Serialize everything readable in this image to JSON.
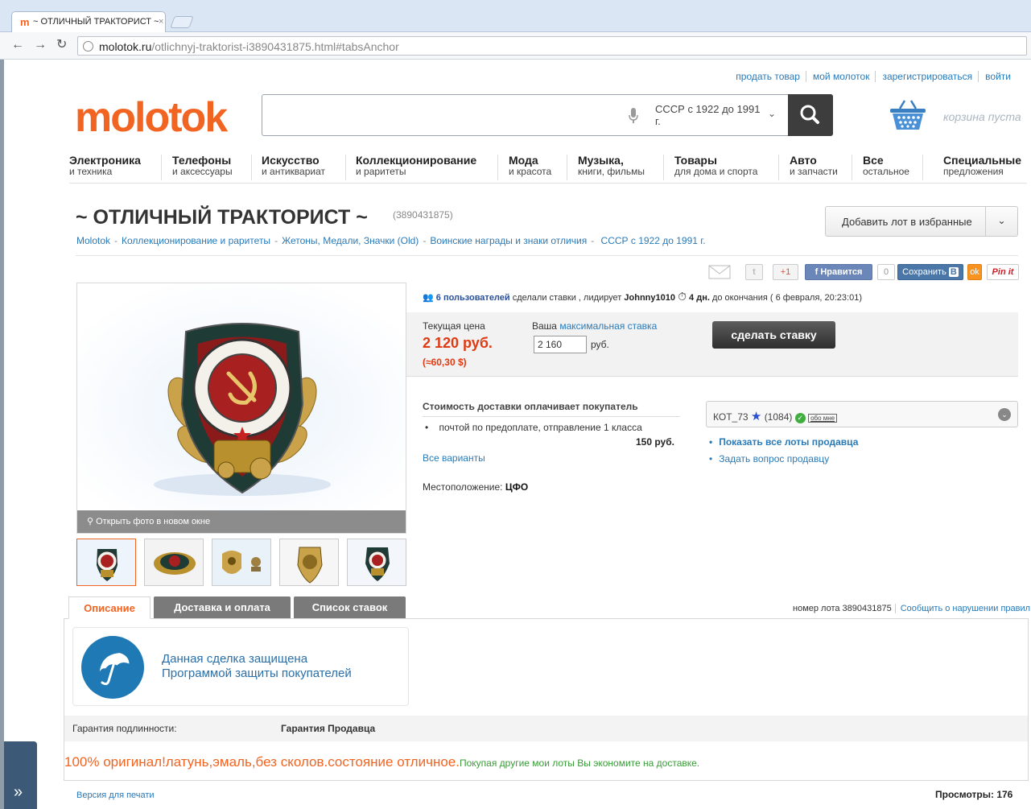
{
  "browser": {
    "tab_title": "~ ОТЛИЧНЫЙ ТРАКТОРИСТ ~",
    "url_host": "molotok.ru",
    "url_path": "/otlichnyj-traktorist-i3890431875.html#tabsAnchor"
  },
  "header": {
    "links": [
      "продать товар",
      "мой молоток",
      "зарегистрироваться",
      "войти"
    ],
    "logo": "molotok",
    "search_placeholder": "",
    "search_category": "СССР с 1922 до 1991 г.",
    "cart_label": "корзина пуста"
  },
  "categories": [
    {
      "title": "Электроника",
      "sub": "и техника"
    },
    {
      "title": "Телефоны",
      "sub": "и аксессуары"
    },
    {
      "title": "Искусство",
      "sub": "и антиквариат"
    },
    {
      "title": "Коллекционирование",
      "sub": "и раритеты"
    },
    {
      "title": "Мода",
      "sub": "и красота"
    },
    {
      "title": "Музыка,",
      "sub": "книги, фильмы"
    },
    {
      "title": "Товары",
      "sub": "для дома и спорта"
    },
    {
      "title": "Авто",
      "sub": "и запчасти"
    },
    {
      "title": "Все",
      "sub": "остальное"
    },
    {
      "title": "Специальные",
      "sub": "предложения"
    }
  ],
  "lot": {
    "title": "~ ОТЛИЧНЫЙ ТРАКТОРИСТ ~",
    "id": "(3890431875)",
    "favorite_button": "Добавить лот в избранные",
    "breadcrumbs": [
      "Molotok",
      "Коллекционирование и раритеты",
      "Жетоны, Медали, Значки (Old)",
      "Воинские награды и знаки отличия",
      "СССР с 1922 до 1991 г."
    ]
  },
  "social": {
    "gplus": "+1",
    "like": "Нравится",
    "like_count": "0",
    "save": "Сохранить",
    "pinit": "Pin it"
  },
  "photo": {
    "open_label": "Открыть фото в новом окне"
  },
  "bids": {
    "users": "6 пользователей",
    "made_bids": "сделали ставки , лидирует",
    "leader": "Johnny1010",
    "time_left": "4 дн.",
    "until": "до окончания ( 6 февраля, 20:23:01)",
    "current_label": "Текущая цена",
    "current_price": "2 120 руб.",
    "price_usd": "(≈60,30 $)",
    "your_label": "Ваша",
    "max_bid_link": "максимальная ставка",
    "bid_value": "2 160",
    "currency": "руб.",
    "bid_button": "сделать ставку"
  },
  "shipping": {
    "heading": "Стоимость доставки оплачивает покупатель",
    "method": "почтой по предоплате, отправление 1 класса",
    "price": "150 руб.",
    "all_options": "Все варианты",
    "location_label": "Местоположение:",
    "location_value": "ЦФО"
  },
  "seller": {
    "name": "КОТ_73",
    "rating": "(1084)",
    "about": "обо мне",
    "show_all": "Показать все лоты продавца",
    "ask": "Задать вопрос продавцу"
  },
  "tabs": [
    "Описание",
    "Доставка и оплата",
    "Список ставок"
  ],
  "lot_number": "номер лота 3890431875",
  "report": "Сообщить о нарушении правил",
  "protection": {
    "line1": "Данная сделка защищена",
    "line2": "Программой защиты покупателей"
  },
  "guarantee": {
    "label": "Гарантия подлинности:",
    "value": "Гарантия Продавца"
  },
  "description": {
    "main": "100% оригинал!латунь,эмаль,без сколов.состояние отличное.",
    "extra": "Покупая  другие мои лоты Вы экономите на доставке."
  },
  "footer": {
    "print": "Версия для печати",
    "views": "Просмотры: 176"
  },
  "colors": {
    "brand": "#f26422",
    "link": "#2a7ab8",
    "price": "#e03a12"
  }
}
